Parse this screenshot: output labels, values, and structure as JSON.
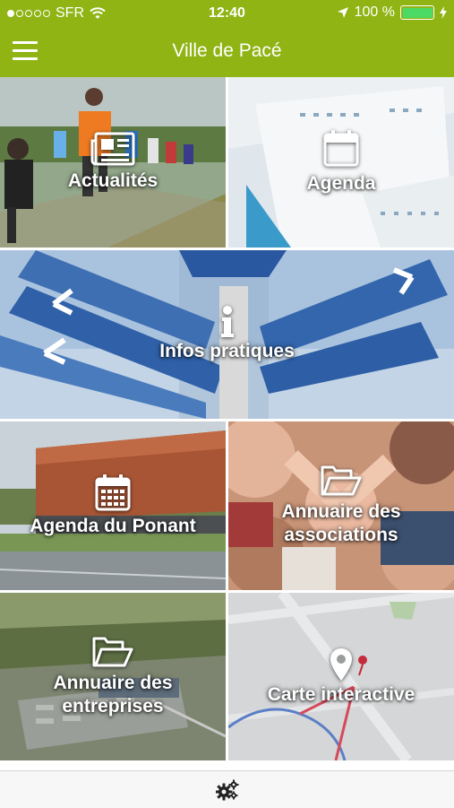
{
  "status_bar": {
    "carrier": "SFR",
    "time": "12:40",
    "battery": "100 %",
    "signal_bars": 1,
    "signal_total": 5
  },
  "nav": {
    "title": "Ville de Pacé",
    "menu_icon": "hamburger-icon",
    "color": "#8fb414"
  },
  "tiles": [
    {
      "label": "Actualités",
      "icon": "newspaper-icon"
    },
    {
      "label": "Agenda",
      "icon": "calendar-icon"
    },
    {
      "label": "Infos pratiques",
      "icon": "info-icon"
    },
    {
      "label": "Agenda du Ponant",
      "icon": "calendar-grid-icon"
    },
    {
      "label_lines": [
        "Annuaire des",
        "associations"
      ],
      "icon": "folder-open-icon"
    },
    {
      "label_lines": [
        "Annuaire des",
        "entreprises"
      ],
      "icon": "folder-open-icon"
    },
    {
      "label": "Carte interactive",
      "icon": "map-marker-icon"
    }
  ],
  "tab_bar": {
    "icon": "gears-icon"
  }
}
